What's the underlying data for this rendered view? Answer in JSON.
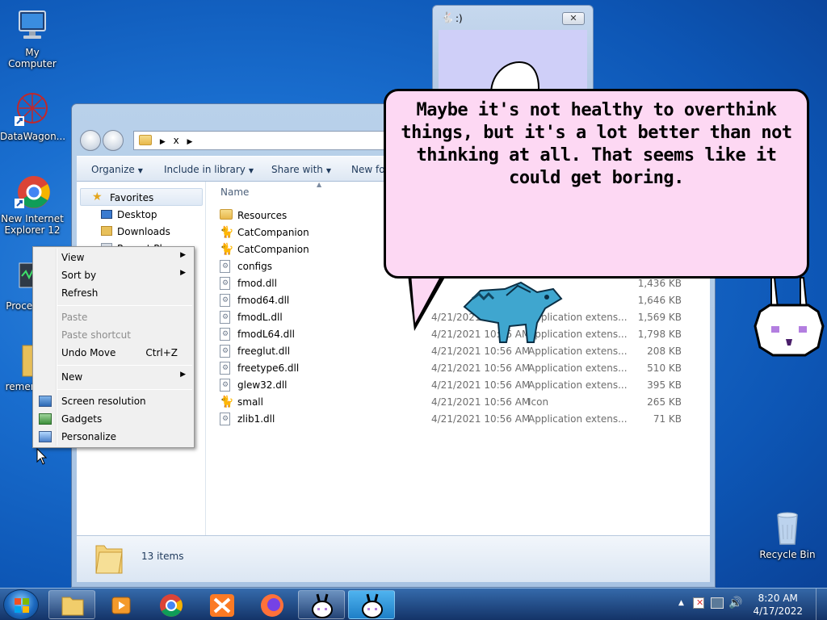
{
  "desktop": {
    "icons": [
      {
        "label": "My Computer"
      },
      {
        "label": "DataWagon..."
      },
      {
        "label": "New Internet Explorer 12"
      },
      {
        "label": "Process"
      },
      {
        "label": "remem"
      },
      {
        "label": "Recycle Bin"
      }
    ]
  },
  "explorer": {
    "address_path": [
      "x"
    ],
    "toolbar": {
      "organize": "Organize",
      "include": "Include in library",
      "share": "Share with",
      "newfolder": "New fo"
    },
    "nav": {
      "favorites": "Favorites",
      "desktop": "Desktop",
      "downloads": "Downloads",
      "recent": "Recent Pl"
    },
    "columns": {
      "name": "Name"
    },
    "files": [
      {
        "name": "Resources",
        "date": "",
        "type": "",
        "size": "",
        "icon": "folder"
      },
      {
        "name": "CatCompanion",
        "date": "",
        "type": "",
        "size": "",
        "icon": "cat"
      },
      {
        "name": "CatCompanion",
        "date": "",
        "type": "",
        "size": "",
        "icon": "cat"
      },
      {
        "name": "configs",
        "date": "",
        "type": "",
        "size": "",
        "icon": "file"
      },
      {
        "name": "fmod.dll",
        "date": "",
        "type": "",
        "size": "1,436 KB",
        "icon": "dll"
      },
      {
        "name": "fmod64.dll",
        "date": "",
        "type": "",
        "size": "1,646 KB",
        "icon": "dll"
      },
      {
        "name": "fmodL.dll",
        "date": "4/21/2021 10:56 AM",
        "type": "Application extens...",
        "size": "1,569 KB",
        "icon": "dll"
      },
      {
        "name": "fmodL64.dll",
        "date": "4/21/2021 10:56 AM",
        "type": "Application extens...",
        "size": "1,798 KB",
        "icon": "dll"
      },
      {
        "name": "freeglut.dll",
        "date": "4/21/2021 10:56 AM",
        "type": "Application extens...",
        "size": "208 KB",
        "icon": "dll"
      },
      {
        "name": "freetype6.dll",
        "date": "4/21/2021 10:56 AM",
        "type": "Application extens...",
        "size": "510 KB",
        "icon": "dll"
      },
      {
        "name": "glew32.dll",
        "date": "4/21/2021 10:56 AM",
        "type": "Application extens...",
        "size": "395 KB",
        "icon": "dll"
      },
      {
        "name": "small",
        "date": "4/21/2021 10:56 AM",
        "type": "Icon",
        "size": "265 KB",
        "icon": "cat"
      },
      {
        "name": "zlib1.dll",
        "date": "4/21/2021 10:56 AM",
        "type": "Application extens...",
        "size": "71 KB",
        "icon": "dll"
      }
    ],
    "status": "13 items"
  },
  "context_menu": {
    "view": "View",
    "sort_by": "Sort by",
    "refresh": "Refresh",
    "paste": "Paste",
    "paste_shortcut": "Paste shortcut",
    "undo_move": "Undo Move",
    "undo_accel": "Ctrl+Z",
    "new": "New",
    "screen_resolution": "Screen resolution",
    "gadgets": "Gadgets",
    "personalize": "Personalize"
  },
  "companion_window": {
    "title": ":)",
    "close_glyph": "✕"
  },
  "speech_bubble": {
    "text": "Maybe it's not healthy to overthink things, but it's a lot better than not thinking at all. That seems like it could get boring."
  },
  "taskbar": {
    "time": "8:20 AM",
    "date": "4/17/2022",
    "apps": [
      "explorer-icon",
      "media-player-icon",
      "chrome-icon",
      "xampp-icon",
      "firefox-icon",
      "bunny-pet-icon",
      "bunny-pet-icon"
    ]
  },
  "colors": {
    "bubble_fill": "#fdd8f3",
    "companion_client": "#cfcff8",
    "desktop_blue": "#1a6fd0"
  }
}
